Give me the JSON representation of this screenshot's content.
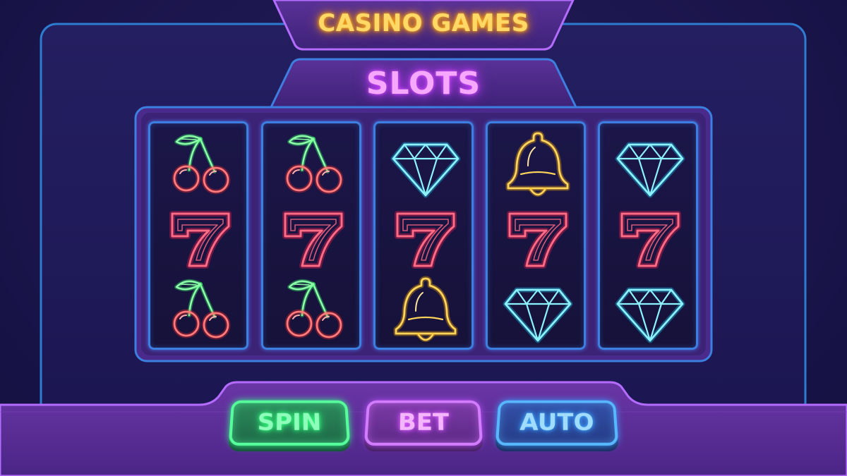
{
  "header": {
    "title": "CASINO GAMES",
    "game_title": "SLOTS"
  },
  "reels": [
    {
      "symbols": [
        "cherry-icon",
        "seven-icon",
        "cherry-icon"
      ]
    },
    {
      "symbols": [
        "cherry-icon",
        "seven-icon",
        "cherry-icon"
      ]
    },
    {
      "symbols": [
        "diamond-icon",
        "seven-icon",
        "bell-icon"
      ]
    },
    {
      "symbols": [
        "bell-icon",
        "seven-icon",
        "diamond-icon"
      ]
    },
    {
      "symbols": [
        "diamond-icon",
        "seven-icon",
        "diamond-icon"
      ]
    }
  ],
  "controls": {
    "spin_label": "SPIN",
    "bet_label": "BET",
    "auto_label": "AUTO"
  },
  "colors": {
    "background": "#1d1750",
    "panel": "#4a2a8a",
    "casino_title": "#ffd866",
    "slots_title": "#f6a8ff",
    "spin": "#57ff9c",
    "bet": "#d37cff",
    "auto": "#58b8ff",
    "reel_border": "#3d7fe0"
  }
}
